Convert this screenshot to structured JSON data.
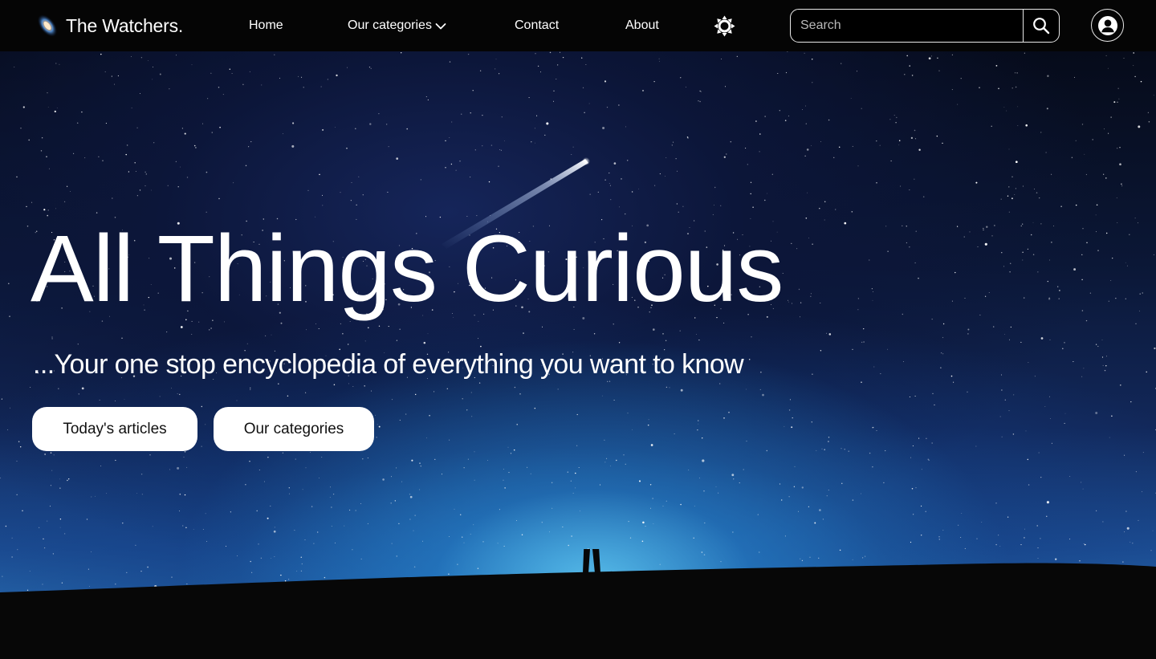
{
  "brand": {
    "name": "The Watchers.",
    "logo_icon": "galaxy-icon"
  },
  "nav": {
    "links": [
      {
        "label": "Home"
      },
      {
        "label": "Our categories",
        "icon": "chevron-down-icon"
      },
      {
        "label": "Contact"
      },
      {
        "label": "About"
      }
    ],
    "theme_toggle_icon": "sun-icon"
  },
  "search": {
    "placeholder": "Search",
    "value": "",
    "button_icon": "search-icon"
  },
  "account": {
    "icon": "user-icon"
  },
  "hero": {
    "title": "All Things Curious",
    "subtitle": "...Your one stop encyclopedia of everything you want to know",
    "buttons": [
      {
        "label": "Today's articles"
      },
      {
        "label": "Our categories"
      }
    ],
    "background": "night-sky-shooting-star-silhouette"
  },
  "colors": {
    "navbar_bg": "#050505",
    "text": "#ffffff",
    "button_bg": "#ffffff",
    "button_text": "#111111",
    "sky_glow": "#5fc8f0",
    "ground": "#070707"
  }
}
